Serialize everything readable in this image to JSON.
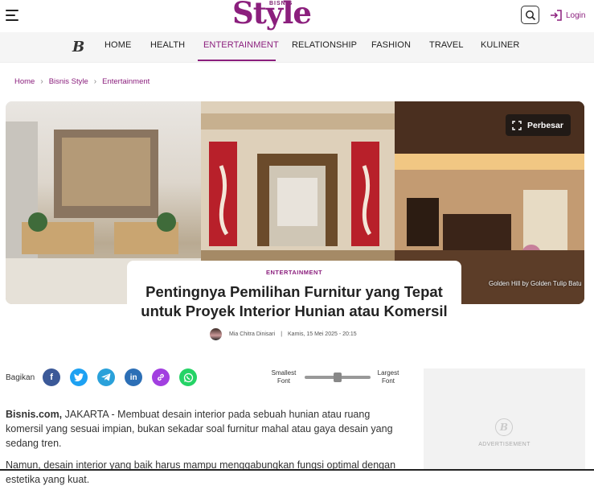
{
  "header": {
    "logo_small": "BISNIS",
    "logo_main": "Style",
    "login_label": "Login"
  },
  "nav": {
    "logo": "B",
    "items": [
      {
        "label": "HOME"
      },
      {
        "label": "HEALTH"
      },
      {
        "label": "ENTERTAINMENT",
        "active": true
      },
      {
        "label": "RELATIONSHIP"
      },
      {
        "label": "FASHION"
      },
      {
        "label": "TRAVEL"
      },
      {
        "label": "KULINER"
      }
    ]
  },
  "breadcrumb": [
    "Home",
    "Bisnis Style",
    "Entertainment"
  ],
  "hero": {
    "enlarge_label": "Perbesar",
    "caption": "Golden Hill by Golden Tulip Batu"
  },
  "article": {
    "category": "ENTERTAINMENT",
    "title_line1": "Pentingnya Pemilihan Furnitur yang Tepat",
    "title_line2": "untuk Proyek Interior Hunian atau Komersil",
    "author": "Mia Chitra Dinisari",
    "date": "Kamis, 15 Mei 2025 - 20:15",
    "lead_source": "Bisnis.com,",
    "para1": " JAKARTA - Membuat desain interior pada sebuah hunian atau ruang komersil yang sesuai impian, bukan sekadar soal furnitur mahal atau gaya desain yang sedang tren.",
    "para2": "Namun, desain interior yang baik harus mampu menggabungkan fungsi optimal dengan estetika yang kuat."
  },
  "share": {
    "label": "Bagikan",
    "buttons": [
      {
        "icon": "facebook-icon",
        "color": "#3b5998",
        "glyph": "f"
      },
      {
        "icon": "twitter-icon",
        "color": "#1da1f2",
        "glyph": "t"
      },
      {
        "icon": "telegram-icon",
        "color": "#2aa1da",
        "glyph": "➤"
      },
      {
        "icon": "linkedin-icon",
        "color": "#2c6fb6",
        "glyph": "in"
      },
      {
        "icon": "link-icon",
        "color": "#a23fe0",
        "glyph": "🔗"
      },
      {
        "icon": "whatsapp-icon",
        "color": "#25d366",
        "glyph": "☏"
      }
    ]
  },
  "font_control": {
    "smallest_line1": "Smallest",
    "smallest_line2": "Font",
    "largest_line1": "Largest",
    "largest_line2": "Font",
    "level": 0.5
  },
  "ad": {
    "mark": "B",
    "label": "ADVERTISEMENT"
  },
  "colors": {
    "brand": "#8b1f7d"
  }
}
